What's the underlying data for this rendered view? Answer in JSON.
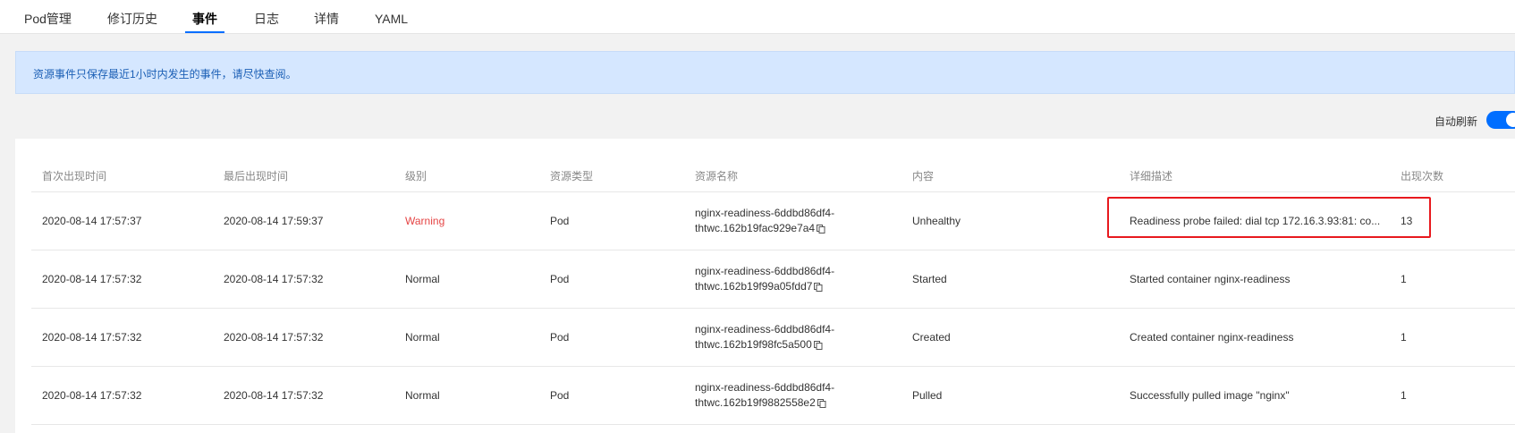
{
  "tabs": [
    {
      "label": "Pod管理"
    },
    {
      "label": "修订历史"
    },
    {
      "label": "事件"
    },
    {
      "label": "日志"
    },
    {
      "label": "详情"
    },
    {
      "label": "YAML"
    }
  ],
  "active_tab": "事件",
  "notice": "资源事件只保存最近1小时内发生的事件，请尽快查阅。",
  "auto_refresh": {
    "label": "自动刷新",
    "enabled": true
  },
  "table": {
    "columns": [
      "首次出现时间",
      "最后出现时间",
      "级别",
      "资源类型",
      "资源名称",
      "内容",
      "详细描述",
      "出现次数"
    ],
    "rows": [
      {
        "first": "2020-08-14 17:57:37",
        "last": "2020-08-14 17:59:37",
        "level": "Warning",
        "type": "Pod",
        "name1": "nginx-readiness-6ddbd86df4-",
        "name2": "thtwc.162b19fac929e7a4",
        "content": "Unhealthy",
        "desc": "Readiness probe failed: dial tcp 172.16.3.93:81: co...",
        "count": "13"
      },
      {
        "first": "2020-08-14 17:57:32",
        "last": "2020-08-14 17:57:32",
        "level": "Normal",
        "type": "Pod",
        "name1": "nginx-readiness-6ddbd86df4-",
        "name2": "thtwc.162b19f99a05fdd7",
        "content": "Started",
        "desc": "Started container nginx-readiness",
        "count": "1"
      },
      {
        "first": "2020-08-14 17:57:32",
        "last": "2020-08-14 17:57:32",
        "level": "Normal",
        "type": "Pod",
        "name1": "nginx-readiness-6ddbd86df4-",
        "name2": "thtwc.162b19f98fc5a500",
        "content": "Created",
        "desc": "Created container nginx-readiness",
        "count": "1"
      },
      {
        "first": "2020-08-14 17:57:32",
        "last": "2020-08-14 17:57:32",
        "level": "Normal",
        "type": "Pod",
        "name1": "nginx-readiness-6ddbd86df4-",
        "name2": "thtwc.162b19f9882558e2",
        "content": "Pulled",
        "desc": "Successfully pulled image \"nginx\"",
        "count": "1"
      }
    ]
  },
  "colors": {
    "accent": "#006eff",
    "warning": "#e54545",
    "highlight": "#e8191e",
    "notice_bg": "#d5e7ff"
  }
}
